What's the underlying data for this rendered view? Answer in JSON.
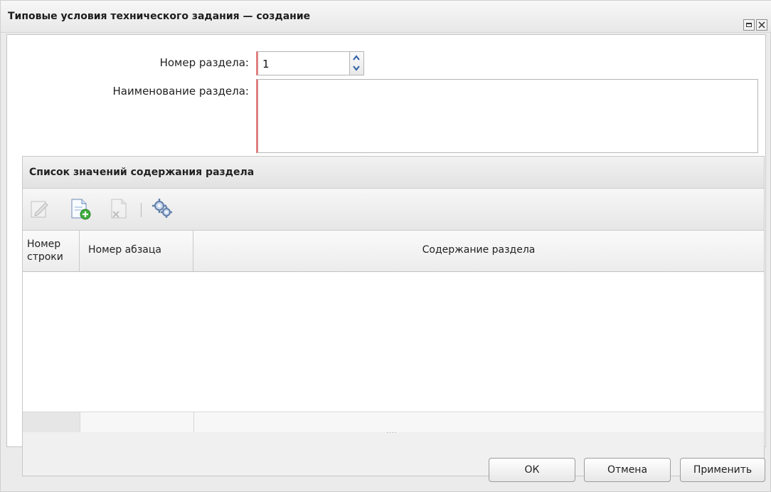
{
  "window": {
    "title": "Типовые условия технического задания — создание",
    "maximize_icon": "maximize-icon",
    "close_icon": "close-icon"
  },
  "form": {
    "section_number_label": "Номер раздела:",
    "section_number_value": "1",
    "section_name_label": "Наименование раздела:",
    "section_name_value": ""
  },
  "panel": {
    "title": "Список значений содержания раздела",
    "toolbar": [
      {
        "name": "edit-icon",
        "enabled": false
      },
      {
        "name": "add-record-icon",
        "enabled": true
      },
      {
        "name": "delete-record-icon",
        "enabled": false
      },
      {
        "name": "settings-gear-icon",
        "enabled": true
      }
    ],
    "columns": [
      {
        "label": "Номер строки"
      },
      {
        "label": "Номер абзаца"
      },
      {
        "label": "Содержание раздела"
      }
    ],
    "rows": [],
    "resize_handle": "...."
  },
  "buttons": {
    "ok": "ОК",
    "cancel": "Отмена",
    "apply": "Применить"
  },
  "colors": {
    "required_marker": "#e08080",
    "window_bg": "#ebebeb"
  }
}
